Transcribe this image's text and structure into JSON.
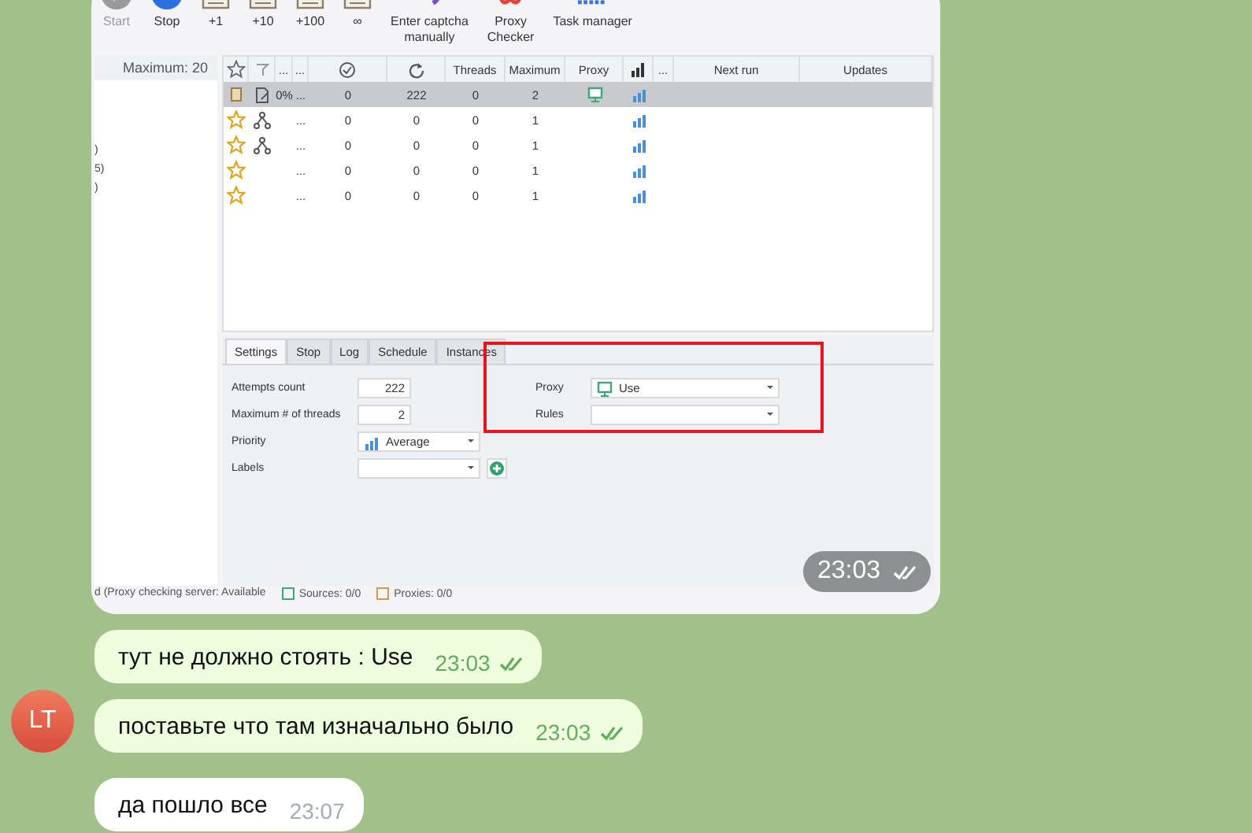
{
  "messages": [
    {
      "kind": "image",
      "outgoing": true,
      "time": "23:03",
      "read": true,
      "screenshot": {
        "toolbar": [
          {
            "kind": "play",
            "label": "Start",
            "disabled": true
          },
          {
            "kind": "stop",
            "label": "Stop",
            "disabled": false
          },
          {
            "kind": "doc",
            "label": "+1",
            "disabled": false
          },
          {
            "kind": "doc",
            "label": "+10",
            "disabled": false
          },
          {
            "kind": "doc",
            "label": "+100",
            "disabled": false
          },
          {
            "kind": "doc",
            "label": "∞",
            "disabled": false
          },
          {
            "kind": "captcha",
            "label": "Enter captcha\nmanually",
            "disabled": false
          },
          {
            "kind": "proxy",
            "label": "Proxy\nChecker",
            "disabled": false
          },
          {
            "kind": "grid",
            "label": "Task manager",
            "disabled": false
          }
        ],
        "left_panel": {
          "header": "Maximum:  20",
          "items": [
            ")",
            "5)",
            ")"
          ]
        },
        "columns": [
          {
            "kind": "star"
          },
          {
            "kind": "filter"
          },
          {
            "kind": "text",
            "label": "..."
          },
          {
            "kind": "text",
            "label": "..."
          },
          {
            "kind": "check"
          },
          {
            "kind": "refresh"
          },
          {
            "kind": "text",
            "label": "Threads"
          },
          {
            "kind": "text",
            "label": "Maximum"
          },
          {
            "kind": "text",
            "label": "Proxy"
          },
          {
            "kind": "bars"
          },
          {
            "kind": "text",
            "label": "..."
          },
          {
            "kind": "text",
            "label": "Next run"
          },
          {
            "kind": "text",
            "label": "Updates"
          }
        ],
        "rows": [
          {
            "selected": true,
            "kind": "task",
            "type": {
              "kind": "edit"
            },
            "progress": "0%",
            "dots": "...",
            "success": "0",
            "attempts": "222",
            "threads": "0",
            "maximum": "2",
            "proxy": true
          },
          {
            "selected": false,
            "kind": "star",
            "type": {
              "kind": "tree"
            },
            "dots": "...",
            "success": "0",
            "attempts": "0",
            "threads": "0",
            "maximum": "1",
            "proxy": false
          },
          {
            "selected": false,
            "kind": "star",
            "type": {
              "kind": "tree"
            },
            "dots": "...",
            "success": "0",
            "attempts": "0",
            "threads": "0",
            "maximum": "1",
            "proxy": false
          },
          {
            "selected": false,
            "kind": "star",
            "dots": "...",
            "success": "0",
            "attempts": "0",
            "threads": "0",
            "maximum": "1",
            "proxy": false
          },
          {
            "selected": false,
            "kind": "star",
            "dots": "...",
            "success": "0",
            "attempts": "0",
            "threads": "0",
            "maximum": "1",
            "proxy": false
          }
        ],
        "tabs": [
          {
            "label": "Settings",
            "selected": true
          },
          {
            "label": "Stop",
            "selected": false
          },
          {
            "label": "Log",
            "selected": false
          },
          {
            "label": "Schedule",
            "selected": false
          },
          {
            "label": "Instances",
            "selected": false
          }
        ],
        "settings_left": [
          {
            "kind": "number",
            "label": "Attempts count",
            "value": "222"
          },
          {
            "kind": "number",
            "label": "Maximum # of threads",
            "value": "2"
          },
          {
            "kind": "priority",
            "label": "Priority",
            "value": "Average"
          },
          {
            "kind": "labels",
            "label": "Labels"
          }
        ],
        "settings_right": [
          {
            "kind": "proxy",
            "label": "Proxy",
            "value": "Use"
          },
          {
            "kind": "select",
            "label": "Rules"
          }
        ],
        "highlight": true,
        "status_bar": [
          "d (Proxy checking server: Available",
          "Sources: 0/0",
          "Proxies: 0/0"
        ]
      }
    },
    {
      "kind": "text",
      "outgoing": true,
      "text": "тут не должно стоять : Use",
      "time": "23:03",
      "read": true
    },
    {
      "kind": "text",
      "outgoing": true,
      "text": "поставьте что там изначально было",
      "time": "23:03",
      "read": true,
      "avatar": "LT"
    },
    {
      "kind": "text",
      "outgoing": false,
      "text": "да пошло все",
      "time": "23:07",
      "read": false
    }
  ]
}
